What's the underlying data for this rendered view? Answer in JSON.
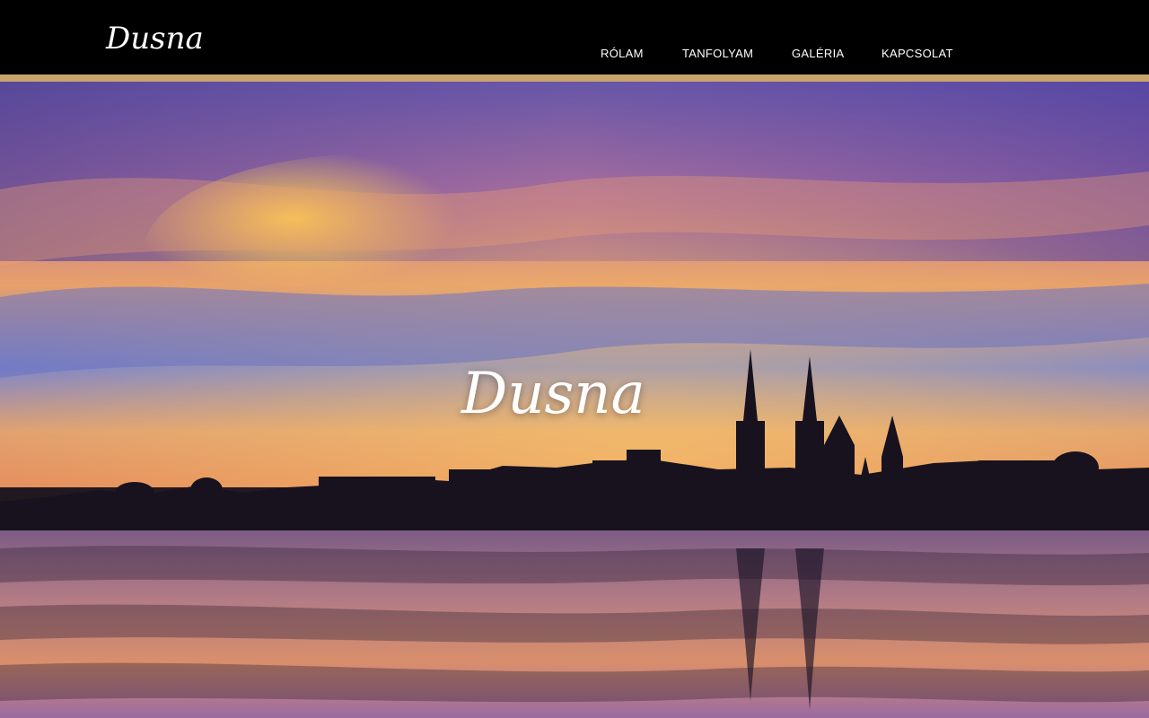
{
  "brand": {
    "logo_text": "Dusna",
    "hero_title": "Dusna"
  },
  "nav": {
    "items": [
      {
        "label": "RÓLAM"
      },
      {
        "label": "TANFOLYAM"
      },
      {
        "label": "GALÉRIA"
      },
      {
        "label": "KAPCSOLAT"
      }
    ]
  },
  "colors": {
    "topbar": "#000000",
    "accent_line": "#c9a46a",
    "nav_text": "#ffffff"
  }
}
